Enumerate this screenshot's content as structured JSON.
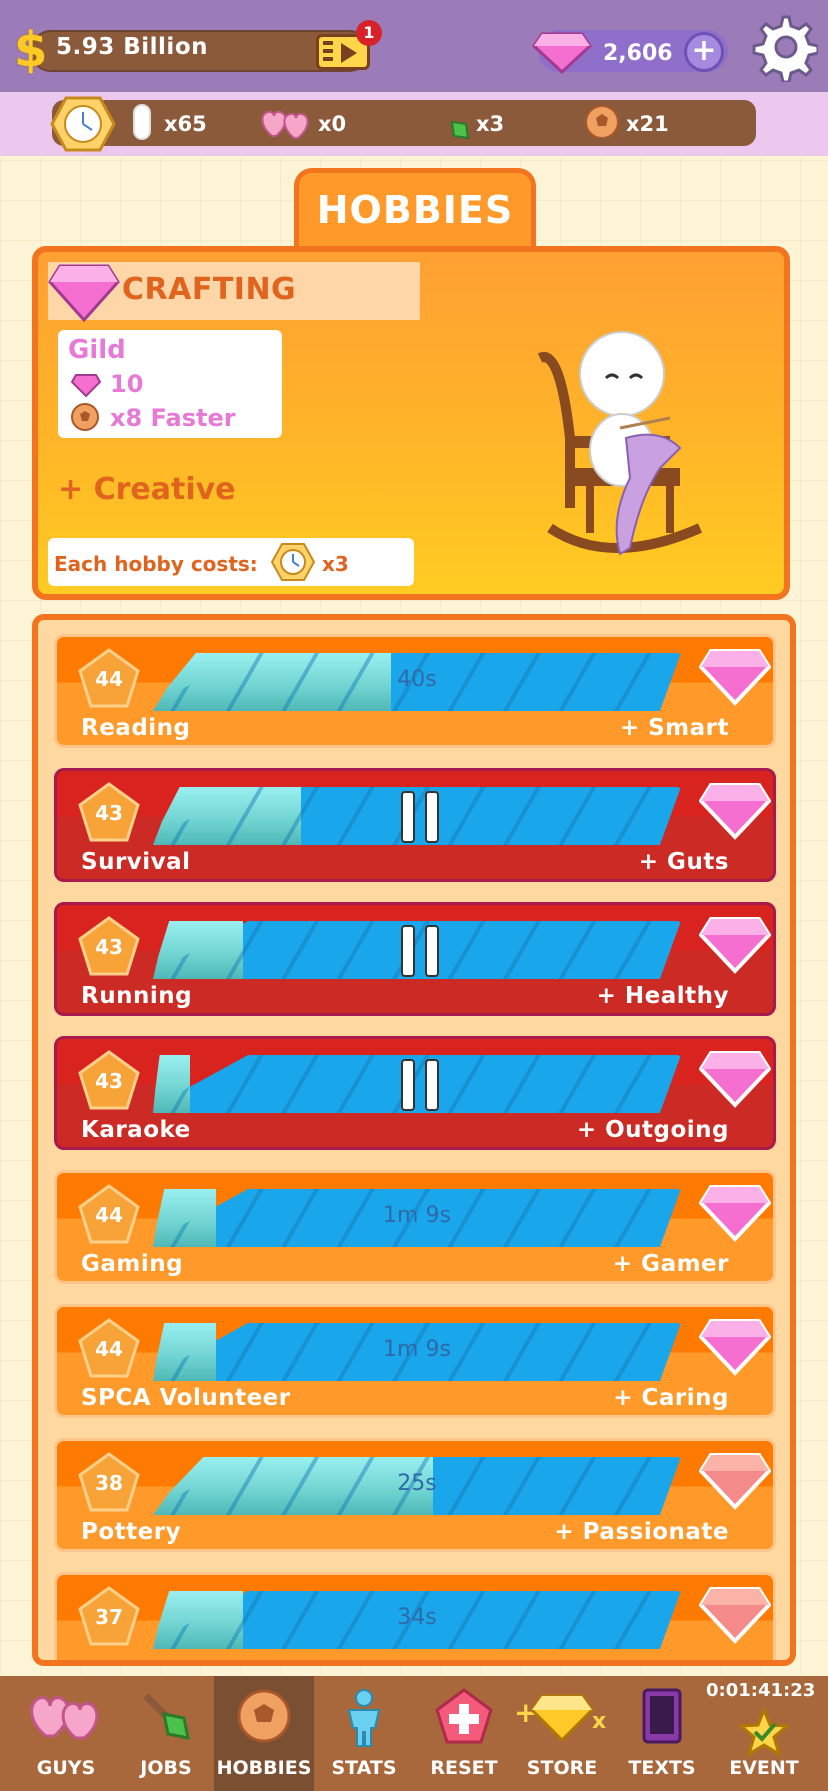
{
  "header": {
    "money": "5.93 Billion",
    "video_badge": "1",
    "gems": "2,606",
    "plus": "+"
  },
  "resources": {
    "time_tokens": "x65",
    "hearts": "x0",
    "shovels": "x3",
    "balls": "x21"
  },
  "tab": {
    "title": "HOBBIES"
  },
  "info": {
    "category": "CRAFTING",
    "gild_title": "Gild",
    "gild_cost": "10",
    "gild_bonus": "x8 Faster",
    "trait": "+ Creative",
    "cost_label": "Each hobby costs:",
    "cost_value": "x3"
  },
  "hobbies": [
    {
      "level": "44",
      "name": "Reading",
      "stat": "+ Smart",
      "timer": "40s",
      "progress": 0.45,
      "state": "running",
      "style": "orange"
    },
    {
      "level": "43",
      "name": "Survival",
      "stat": "+ Guts",
      "timer": "",
      "progress": 0.28,
      "state": "paused",
      "style": "red"
    },
    {
      "level": "43",
      "name": "Running",
      "stat": "+ Healthy",
      "timer": "",
      "progress": 0.17,
      "state": "paused",
      "style": "red"
    },
    {
      "level": "43",
      "name": "Karaoke",
      "stat": "+ Outgoing",
      "timer": "",
      "progress": 0.07,
      "state": "paused",
      "style": "red"
    },
    {
      "level": "44",
      "name": "Gaming",
      "stat": "+ Gamer",
      "timer": "1m 9s",
      "progress": 0.12,
      "state": "running",
      "style": "orange"
    },
    {
      "level": "44",
      "name": "SPCA Volunteer",
      "stat": "+ Caring",
      "timer": "1m 9s",
      "progress": 0.12,
      "state": "running",
      "style": "orange"
    },
    {
      "level": "38",
      "name": "Pottery",
      "stat": "+ Passionate",
      "timer": "25s",
      "progress": 0.53,
      "state": "running",
      "style": "orange"
    },
    {
      "level": "37",
      "name": "",
      "stat": "",
      "timer": "34s",
      "progress": 0.17,
      "state": "running",
      "style": "orange"
    }
  ],
  "nav": {
    "guys": "GUYS",
    "jobs": "JOBS",
    "hobbies": "HOBBIES",
    "stats": "STATS",
    "reset": "RESET",
    "store": "STORE",
    "texts": "TEXTS",
    "event": "EVENT",
    "timer": "0:01:41:23"
  },
  "colors": {
    "accent_orange": "#ff9a2a",
    "active_red": "#d8231e",
    "progress_blue": "#1aa6ea",
    "gem_pink": "#f46fd0"
  }
}
